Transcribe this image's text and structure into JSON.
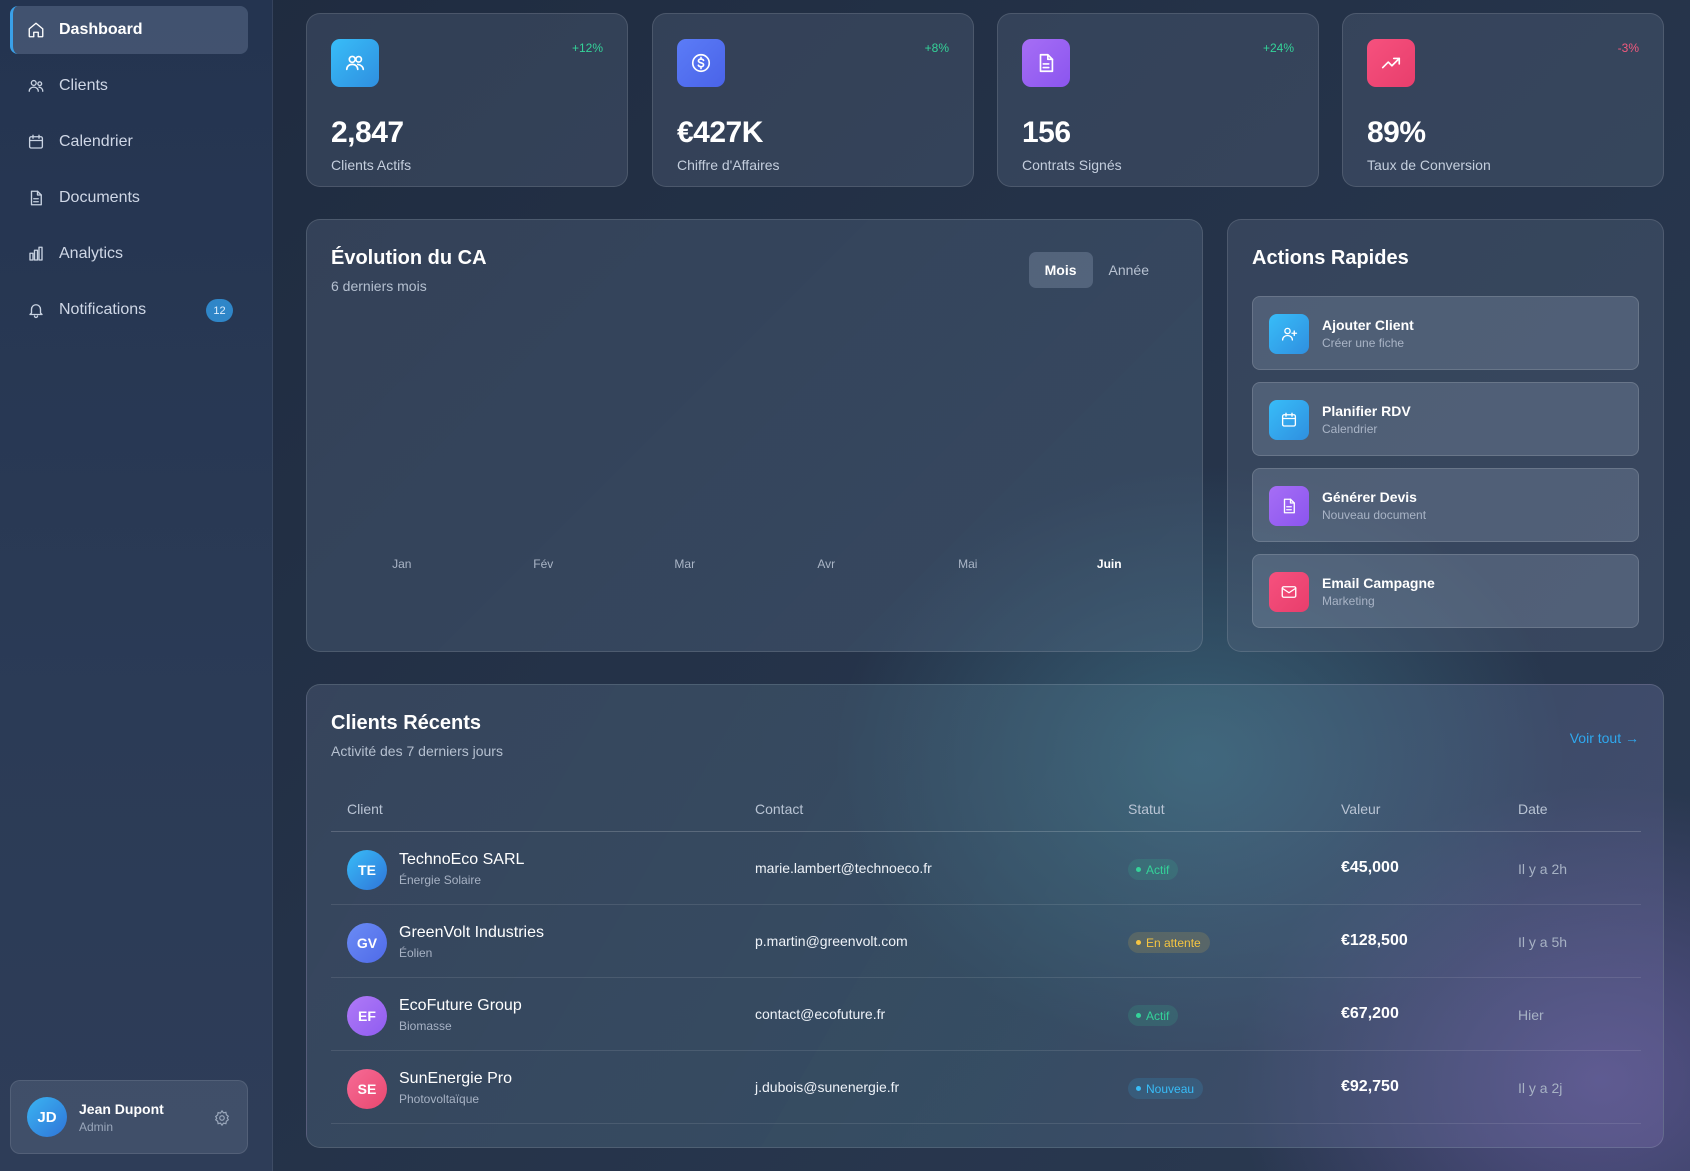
{
  "sidebar": {
    "items": [
      {
        "label": "Dashboard",
        "icon": "home-icon"
      },
      {
        "label": "Clients",
        "icon": "users-icon"
      },
      {
        "label": "Calendrier",
        "icon": "calendar-icon"
      },
      {
        "label": "Documents",
        "icon": "document-icon"
      },
      {
        "label": "Analytics",
        "icon": "bar-chart-icon"
      },
      {
        "label": "Notifications",
        "icon": "bell-icon",
        "badge": "12"
      }
    ],
    "user": {
      "initials": "JD",
      "name": "Jean Dupont",
      "role": "Admin"
    }
  },
  "stats": [
    {
      "value": "2,847",
      "label": "Clients Actifs",
      "delta": "+12%",
      "delta_color": "#34d399",
      "icon": "users-icon",
      "gradient": [
        "#38bdf8",
        "#2f8fe0"
      ]
    },
    {
      "value": "€427K",
      "label": "Chiffre d'Affaires",
      "delta": "+8%",
      "delta_color": "#34d399",
      "icon": "dollar-icon",
      "gradient": [
        "#5b7cf7",
        "#4a63e8"
      ]
    },
    {
      "value": "156",
      "label": "Contrats Signés",
      "delta": "+24%",
      "delta_color": "#34d399",
      "icon": "document-icon",
      "gradient": [
        "#a66ef5",
        "#8b55ef"
      ]
    },
    {
      "value": "89%",
      "label": "Taux de Conversion",
      "delta": "-3%",
      "delta_color": "#f25a7e",
      "icon": "trending-up-icon",
      "gradient": [
        "#f6517e",
        "#e83e6c"
      ]
    }
  ],
  "chart": {
    "title": "Évolution du CA",
    "subtitle": "6 derniers mois",
    "toggle": {
      "month": "Mois",
      "year": "Année"
    }
  },
  "chart_data": {
    "type": "bar",
    "categories": [
      "Jan",
      "Fév",
      "Mar",
      "Avr",
      "Mai",
      "Juin"
    ],
    "highlight": "Juin",
    "values": []
  },
  "quick_actions": {
    "title": "Actions Rapides",
    "items": [
      {
        "title": "Ajouter Client",
        "subtitle": "Créer une fiche",
        "icon": "user-plus-icon",
        "gradient": [
          "#38bdf8",
          "#2f8fe0"
        ]
      },
      {
        "title": "Planifier RDV",
        "subtitle": "Calendrier",
        "icon": "calendar-icon",
        "gradient": [
          "#38bdf8",
          "#2f8fe0"
        ]
      },
      {
        "title": "Générer Devis",
        "subtitle": "Nouveau document",
        "icon": "document-icon",
        "gradient": [
          "#a66ef5",
          "#8b55ef"
        ]
      },
      {
        "title": "Email Campagne",
        "subtitle": "Marketing",
        "icon": "mail-icon",
        "gradient": [
          "#f6517e",
          "#e83e6c"
        ]
      }
    ]
  },
  "clients": {
    "title": "Clients Récents",
    "subtitle": "Activité des 7 derniers jours",
    "view_all": "Voir tout →",
    "columns": [
      "Client",
      "Contact",
      "Statut",
      "Valeur",
      "Date"
    ],
    "rows": [
      {
        "initials": "TE",
        "name": "TechnoEco SARL",
        "sector": "Énergie Solaire",
        "email": "marie.lambert@technoeco.fr",
        "status": "Actif",
        "status_color": "#34d399",
        "status_bg": "rgba(52,211,153,0.15)",
        "value": "€45,000",
        "date": "Il y a 2h",
        "gradient": [
          "#38bdf8",
          "#2f74d8"
        ]
      },
      {
        "initials": "GV",
        "name": "GreenVolt Industries",
        "sector": "Éolien",
        "email": "p.martin@greenvolt.com",
        "status": "En attente",
        "status_color": "#f5c542",
        "status_bg": "rgba(245,197,66,0.15)",
        "value": "€128,500",
        "date": "Il y a 5h",
        "gradient": [
          "#6b8cf5",
          "#4f6ae8"
        ]
      },
      {
        "initials": "EF",
        "name": "EcoFuture Group",
        "sector": "Biomasse",
        "email": "contact@ecofuture.fr",
        "status": "Actif",
        "status_color": "#34d399",
        "status_bg": "rgba(52,211,153,0.15)",
        "value": "€67,200",
        "date": "Hier",
        "gradient": [
          "#b07af7",
          "#8f5cf0"
        ]
      },
      {
        "initials": "SE",
        "name": "SunEnergie Pro",
        "sector": "Photovoltaïque",
        "email": "j.dubois@sunenergie.fr",
        "status": "Nouveau",
        "status_color": "#38bdf8",
        "status_bg": "rgba(56,189,248,0.15)",
        "value": "€92,750",
        "date": "Il y a 2j",
        "gradient": [
          "#f76b96",
          "#e8486f"
        ]
      }
    ]
  }
}
